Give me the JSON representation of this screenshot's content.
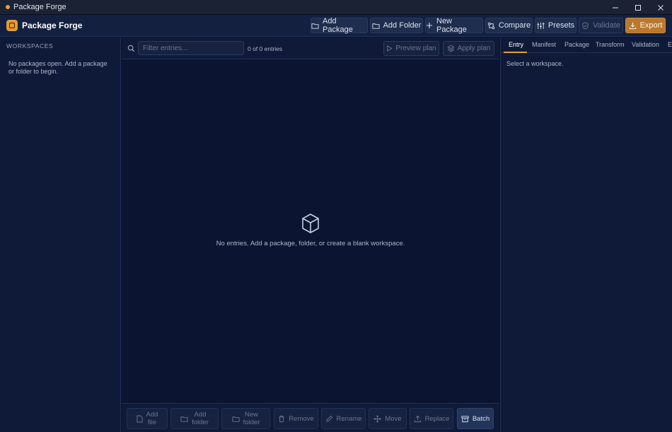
{
  "window": {
    "title": "Package Forge",
    "controls": [
      "minimize-icon",
      "maximize-icon",
      "close-icon"
    ]
  },
  "toolbar": {
    "brand": "Package Forge",
    "buttons": {
      "add_package": "Add Package",
      "add_folder": "Add Folder",
      "new_package": "New Package",
      "compare": "Compare",
      "presets": "Presets",
      "validate": "Validate",
      "export": "Export"
    }
  },
  "sidebar": {
    "heading": "WORKSPACES",
    "empty_message": "No packages open. Add a package or folder to begin."
  },
  "entries": {
    "filter_placeholder": "Filter entries...",
    "filter_value": "",
    "count": "0 of 0 entries",
    "preview_plan": "Preview plan",
    "apply_plan": "Apply plan",
    "empty_message": "No entries. Add a package, folder, or create a blank workspace."
  },
  "actions": {
    "add_file_1": "Add",
    "add_file_2": "file",
    "add_folder_1": "Add",
    "add_folder_2": "folder",
    "new_folder_1": "New",
    "new_folder_2": "folder",
    "remove": "Remove",
    "rename": "Rename",
    "move": "Move",
    "replace": "Replace",
    "batch": "Batch"
  },
  "inspector": {
    "tabs": {
      "entry": "Entry",
      "manifest": "Manifest",
      "package": "Package",
      "transform": "Transform",
      "validation": "Validation",
      "ex": "Ex"
    },
    "active_tab": "Entry",
    "message": "Select a workspace."
  },
  "colors": {
    "accent": "#e3a23c",
    "export_button": "#b8792e",
    "background": "#0b1430",
    "panel": "#0f1a38"
  }
}
